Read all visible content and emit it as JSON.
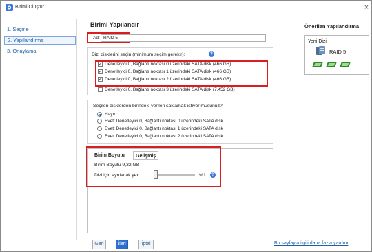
{
  "window": {
    "title": "Birimi Oluştur...",
    "close_symbol": "×"
  },
  "nav": {
    "items": [
      {
        "label": "1. Seçme"
      },
      {
        "label": "2. Yapılandırma"
      },
      {
        "label": "3. Onaylama"
      }
    ],
    "active_index": 1
  },
  "main": {
    "title": "Birimi Yapılandır",
    "name_label": "Ad:",
    "name_value": "RAID 5",
    "disks_label": "Dizi disklerini seçin (minimum seçim gerekir):",
    "disks": [
      {
        "label": "Denetleyici 0, Bağlantı noktası 0 üzerindeki SATA disk (466 GB)",
        "checked": true
      },
      {
        "label": "Denetleyici 0, Bağlantı noktası 1 üzerindeki SATA disk (466 GB)",
        "checked": true
      },
      {
        "label": "Denetleyici 0, Bağlantı noktası 2 üzerindeki SATA disk (466 GB)",
        "checked": true
      },
      {
        "label": "Denetleyici 0, Bağlantı noktası 3 üzerindeki SATA disk (7.452 GB)",
        "checked": false
      }
    ],
    "keep_data_label": "Seçilen disklerden birindeki verileri saklamak istiyor musunuz?",
    "keep_data_options": [
      {
        "label": "Hayır",
        "selected": true
      },
      {
        "label": "Evet: Denetleyici 0, Bağlantı noktası 0 üzerindeki SATA disk",
        "selected": false
      },
      {
        "label": "Evet: Denetleyici 0, Bağlantı noktası 1 üzerindeki SATA disk",
        "selected": false
      },
      {
        "label": "Evet: Denetleyici 0, Bağlantı noktası 2 üzerindeki SATA disk",
        "selected": false
      }
    ],
    "tabs": [
      {
        "label": "Birim Boyutu"
      },
      {
        "label": "Gelişmiş"
      }
    ],
    "size_text": "Birim Boyutu 9,32 GB",
    "reserve_label": "Dizi için ayrılacak yer:",
    "reserve_value": "%1",
    "reserve_fraction": 0.01
  },
  "suggested": {
    "title": "Önerilen Yapılandırma",
    "header": "Yeni Dizi",
    "raid_label": "RAID 5",
    "icons": [
      "server-icon",
      "disk-icon",
      "disk-icon",
      "disk-icon"
    ]
  },
  "footer": {
    "back": "Geri",
    "next": "İleri",
    "cancel": "İptal",
    "help_link": "Bu sayfayla ilgili daha fazla yardım"
  },
  "colors": {
    "accent": "#2d6fd0",
    "highlight": "#d81e1e",
    "link": "#1e5fa8"
  }
}
